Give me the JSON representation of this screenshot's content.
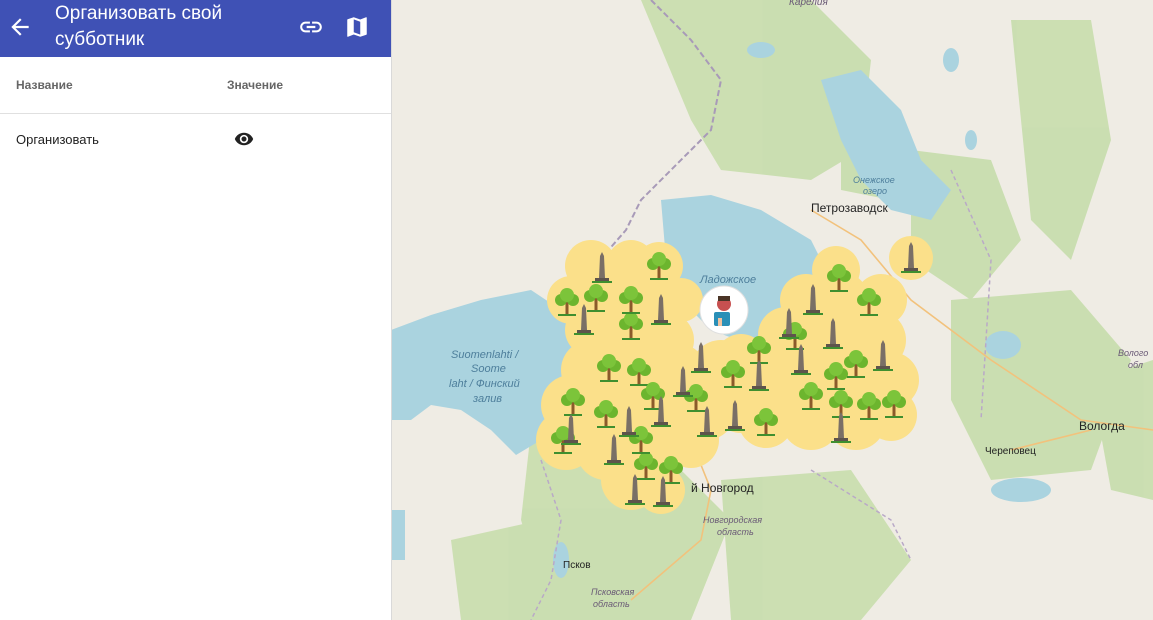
{
  "app": {
    "title": "Организовать свой субботник",
    "icons": {
      "back": "arrow-back-icon",
      "link": "link-icon",
      "map": "map-icon"
    }
  },
  "table": {
    "headers": {
      "name": "Название",
      "value": "Значение"
    },
    "rows": [
      {
        "name": "Организовать",
        "value_icon": "eye-icon"
      }
    ]
  },
  "map": {
    "labels": {
      "karelia": "Карелия",
      "onega_lake_1": "Онежское",
      "onega_lake_2": "озеро",
      "petrozavodsk": "Петрозаводск",
      "ladoga_1": "Ладожское",
      "gulf_1": "Suomenlahti /",
      "gulf_2": "Soome",
      "gulf_3": "laht / Финский",
      "gulf_4": "залив",
      "novgorod": "й Новгород",
      "novgorod_oblast_1": "Новгородская",
      "novgorod_oblast_2": "область",
      "pskov": "Псков",
      "pskov_oblast_1": "Псковская",
      "pskov_oblast_2": "область",
      "vologda": "Вологда",
      "vologda_oblast_1": "Волого",
      "vologda_oblast_2": "обл",
      "cherepovets": "Череповец"
    },
    "colors": {
      "land": "#efece4",
      "forest": "#c9deaf",
      "water": "#aad3df",
      "cluster": "#fbe08a",
      "tree_crown": "#6cb52e",
      "tree_trunk": "#8b5a2b",
      "monument": "#7a6f66",
      "grass": "#3f8f2f"
    },
    "markers": {
      "tree_icon": "tree-icon",
      "monument_icon": "monument-icon",
      "user_marker_icon": "user-location-icon"
    }
  }
}
